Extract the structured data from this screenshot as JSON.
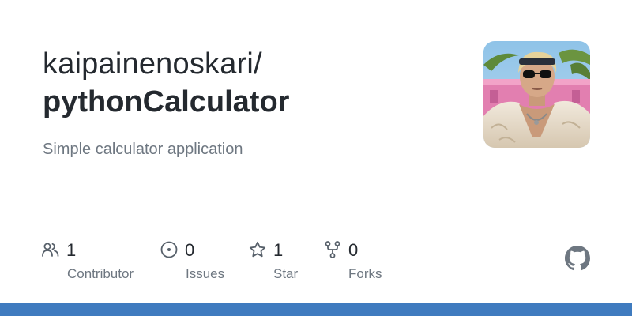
{
  "repo": {
    "owner": "kaipainenoskari/",
    "name": "pythonCalculator",
    "description": "Simple calculator application"
  },
  "stats": {
    "contributors": {
      "value": "1",
      "label": "Contributor",
      "icon": "people-icon"
    },
    "issues": {
      "value": "0",
      "label": "Issues",
      "icon": "issue-opened-icon"
    },
    "stars": {
      "value": "1",
      "label": "Star",
      "icon": "star-icon"
    },
    "forks": {
      "value": "0",
      "label": "Forks",
      "icon": "repo-forked-icon"
    }
  },
  "colors": {
    "text_primary": "#24292f",
    "text_muted": "#6e7781",
    "bottom_bar": "#3f7bbf"
  }
}
